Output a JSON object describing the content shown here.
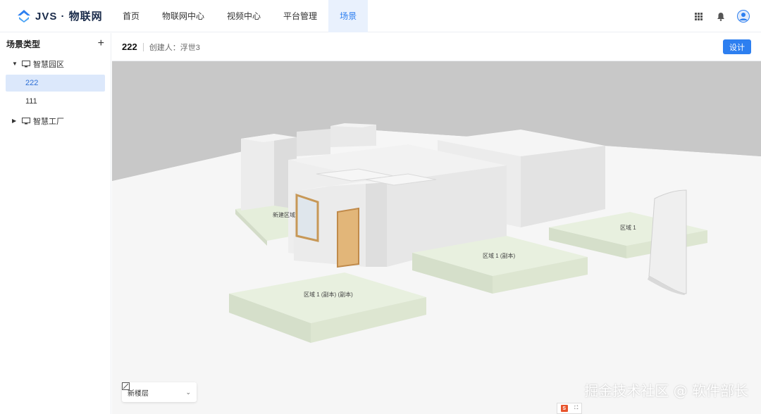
{
  "app": {
    "logo_text": "JVS · 物联网"
  },
  "nav": {
    "items": [
      {
        "label": "首页"
      },
      {
        "label": "物联网中心"
      },
      {
        "label": "视频中心"
      },
      {
        "label": "平台管理"
      },
      {
        "label": "场景"
      }
    ],
    "active": "场景"
  },
  "topbar_icons": [
    "apps-grid-icon",
    "bell-icon",
    "user-avatar-icon"
  ],
  "sidebar": {
    "title": "场景类型",
    "add_label": "+",
    "tree": [
      {
        "label": "智慧园区",
        "expanded": true,
        "children": [
          {
            "label": "222",
            "selected": true
          },
          {
            "label": "111"
          }
        ]
      },
      {
        "label": "智慧工厂",
        "expanded": false
      }
    ]
  },
  "scene_header": {
    "name": "222",
    "creator": "创建人：浮世3",
    "design_button": "设计"
  },
  "viewport": {
    "region_labels": {
      "new_region": "新建区域",
      "region1": "区域 1",
      "region1_copy": "区域 1 (副本)",
      "region1_copy_copy": "区域 1 (副本) (副本)"
    },
    "floor_select": {
      "value": "新楼层"
    },
    "watermark": "掘金技术社区 @ 软件部长"
  },
  "colors": {
    "accent": "#2d7ff0",
    "nav_active_bg": "#e9f1fd",
    "selected_bg": "#dce8fb",
    "floor_plate": "#e8f0df",
    "door": "#d9a86a"
  }
}
